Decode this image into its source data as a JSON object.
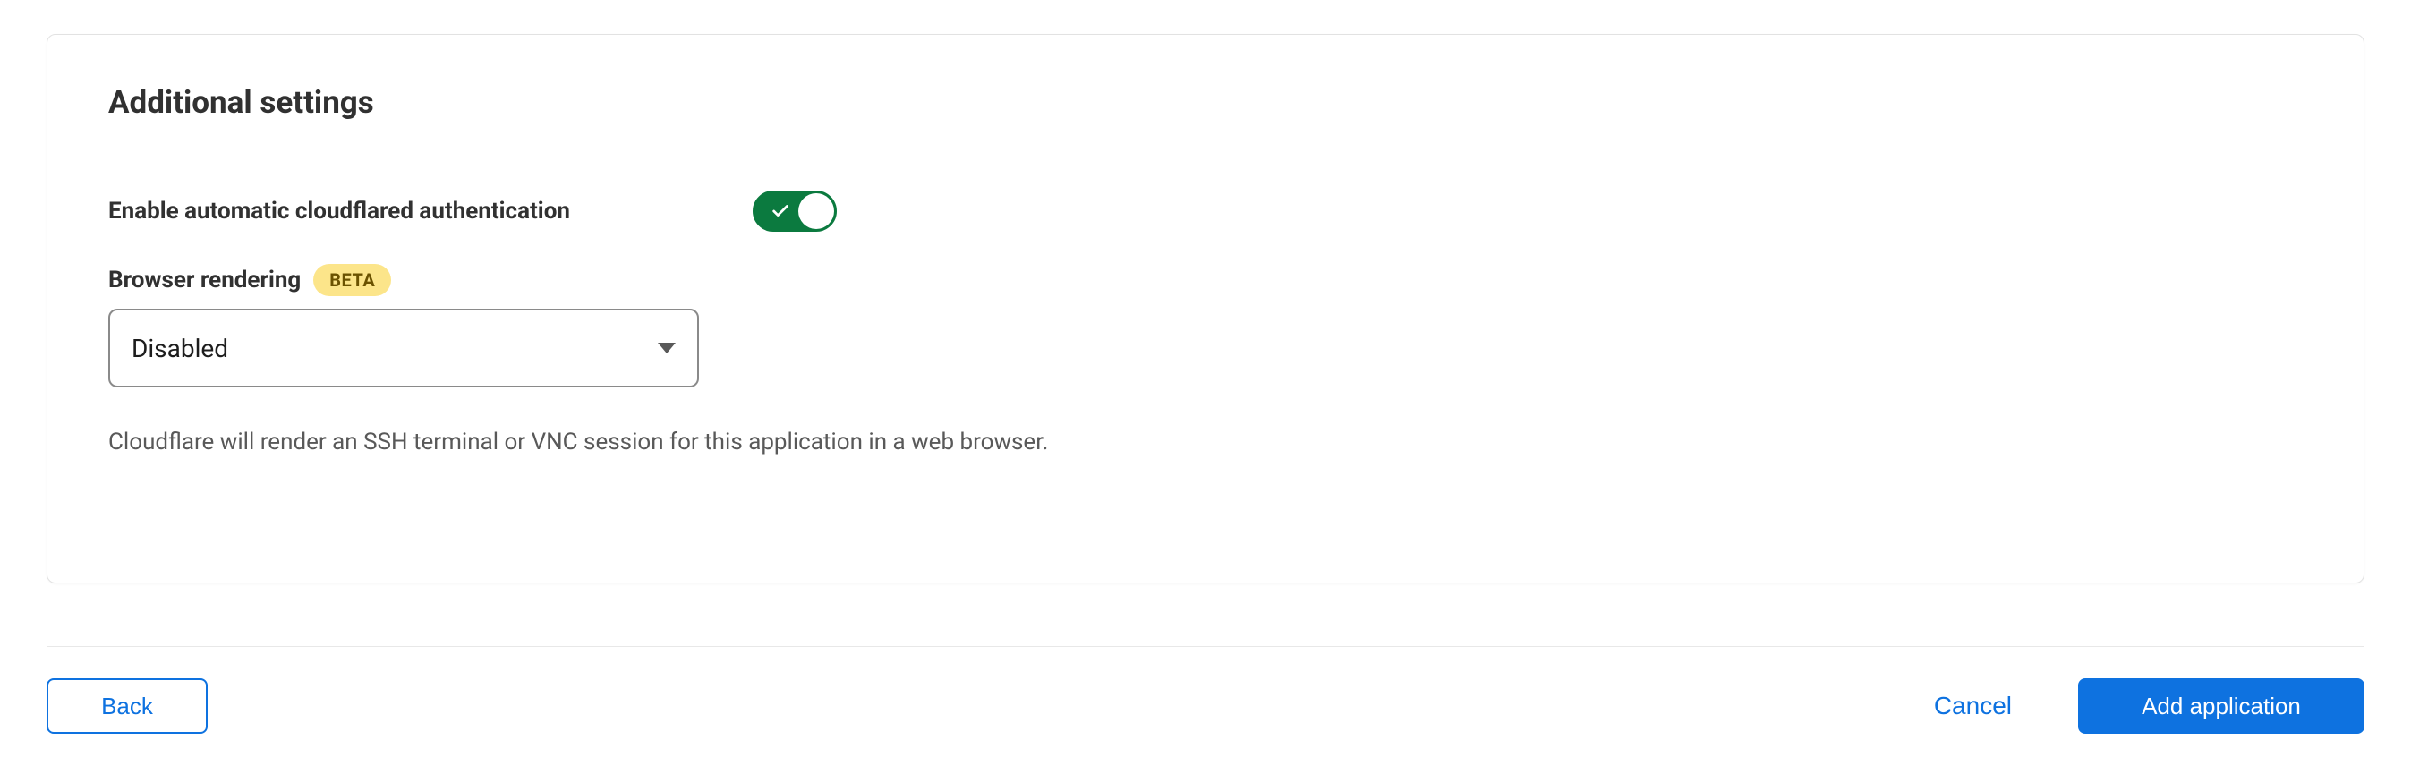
{
  "section": {
    "title": "Additional settings"
  },
  "settings": {
    "auto_auth": {
      "label": "Enable automatic cloudflared authentication",
      "enabled": true
    },
    "browser_rendering": {
      "label": "Browser rendering",
      "badge": "BETA",
      "selected": "Disabled",
      "help": "Cloudflare will render an SSH terminal or VNC session for this application in a web browser."
    }
  },
  "footer": {
    "back": "Back",
    "cancel": "Cancel",
    "add": "Add application"
  }
}
